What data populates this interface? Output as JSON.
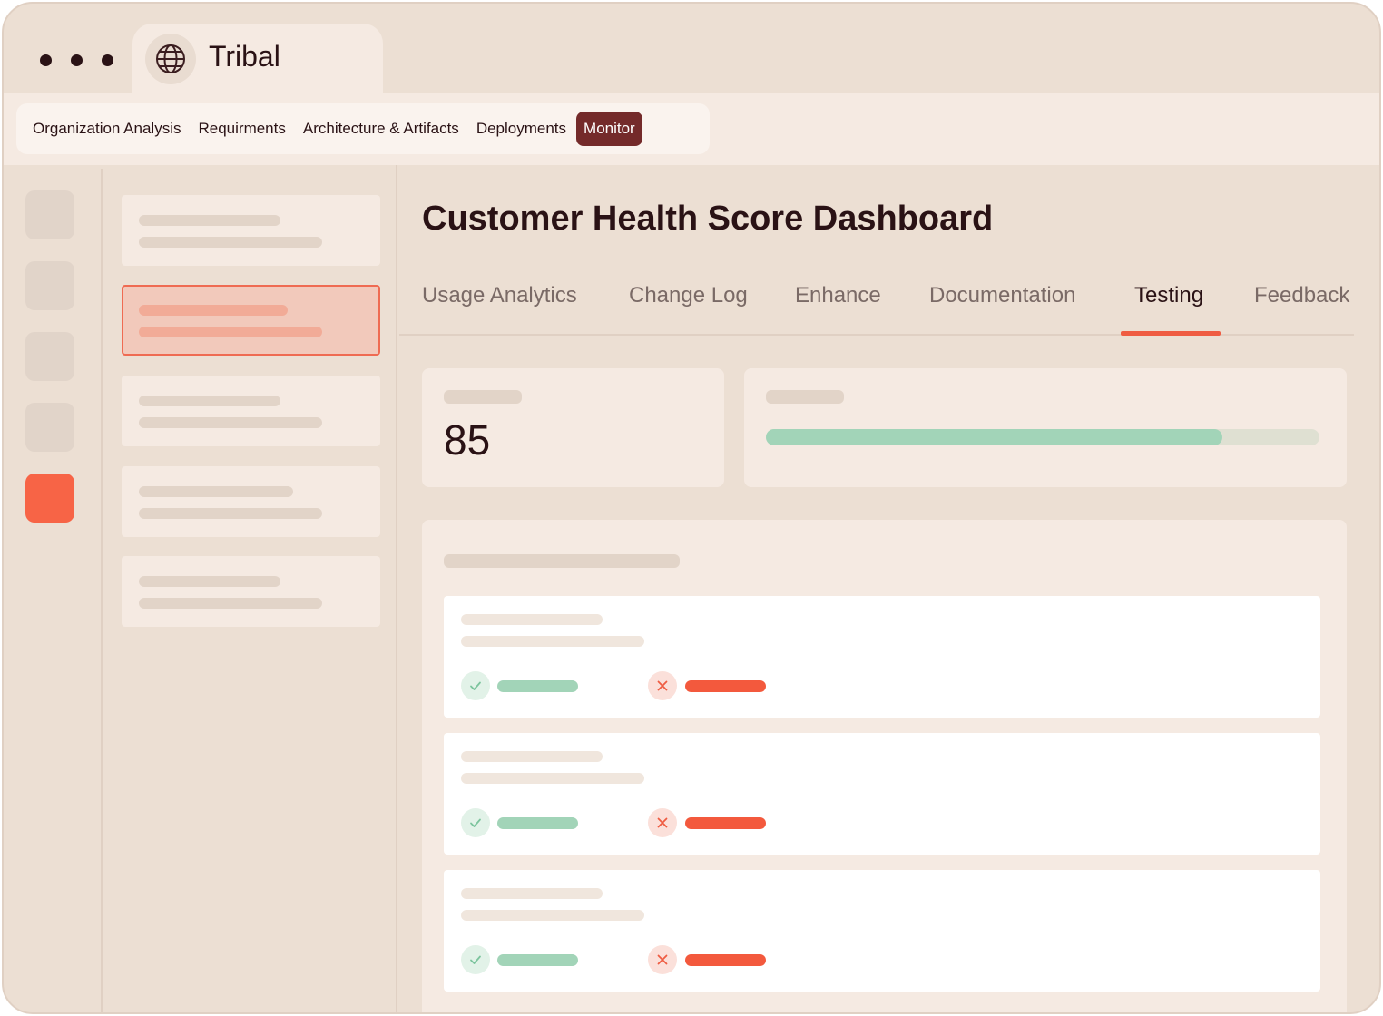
{
  "browser_tab": {
    "title": "Tribal",
    "icon": "globe-icon"
  },
  "nav": {
    "items": [
      {
        "label": "Organization Analysis"
      },
      {
        "label": "Requirments"
      },
      {
        "label": "Architecture & Artifacts"
      },
      {
        "label": "Deployments"
      },
      {
        "label": "Monitor",
        "active": true
      }
    ]
  },
  "page": {
    "title": "Customer Health Score Dashboard"
  },
  "tabs": [
    {
      "label": "Usage Analytics"
    },
    {
      "label": "Change Log"
    },
    {
      "label": "Enhance"
    },
    {
      "label": "Documentation"
    },
    {
      "label": "Testing",
      "active": true
    },
    {
      "label": "Feedback"
    }
  ],
  "metric": {
    "value": "85"
  },
  "progress": {
    "fraction": 0.825
  },
  "test_results": [
    {
      "pass_icon": "check-icon",
      "fail_icon": "x-icon"
    },
    {
      "pass_icon": "check-icon",
      "fail_icon": "x-icon"
    },
    {
      "pass_icon": "check-icon",
      "fail_icon": "x-icon"
    }
  ],
  "colors": {
    "accent": "#f76446",
    "active_nav": "#742a2a",
    "pass": "#a2d4b8",
    "fail": "#f3593d",
    "background": "#ecdfd3"
  }
}
